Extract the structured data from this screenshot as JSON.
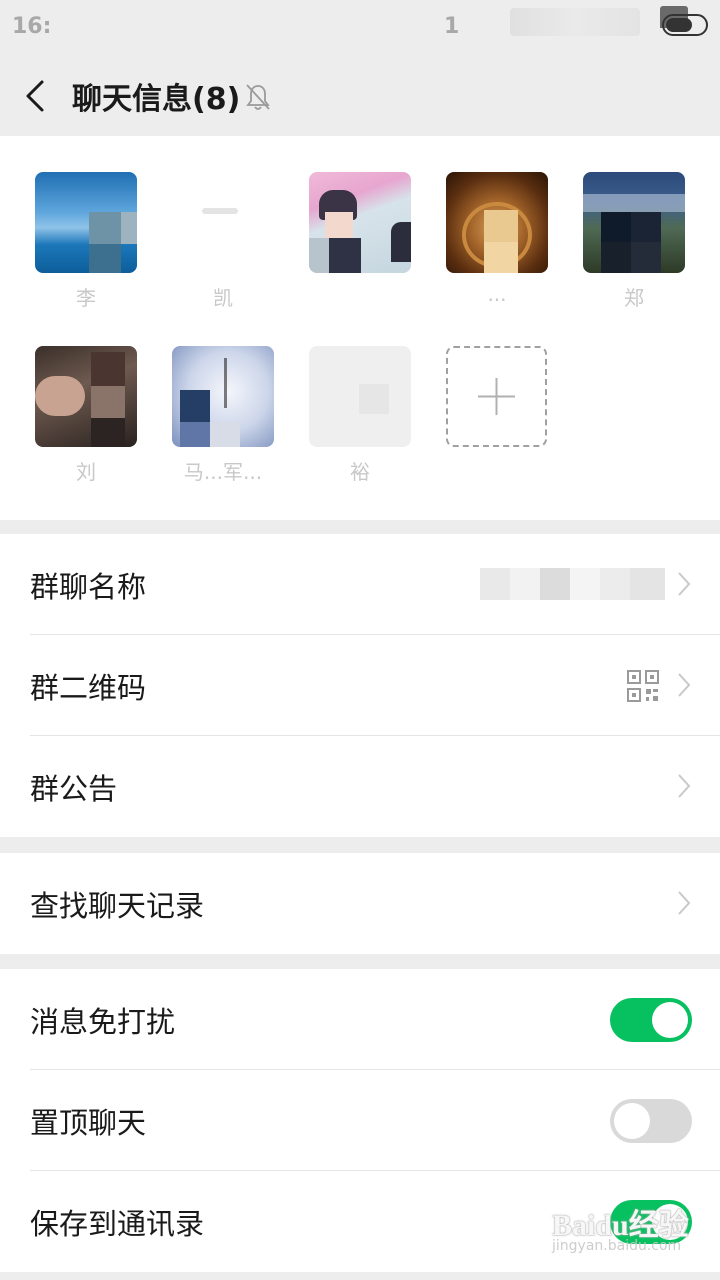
{
  "status_bar": {
    "time": "16:",
    "indicator": "1"
  },
  "header": {
    "title": "聊天信息(8)"
  },
  "members": [
    {
      "name": "李"
    },
    {
      "name": "凯"
    },
    {
      "name": ""
    },
    {
      "name": "..."
    },
    {
      "name": "郑"
    },
    {
      "name": "刘"
    },
    {
      "name": "马...军..."
    },
    {
      "name": "裕"
    }
  ],
  "settings": {
    "group_name_label": "群聊名称",
    "group_qr_label": "群二维码",
    "group_notice_label": "群公告",
    "search_history_label": "查找聊天记录",
    "mute_label": "消息免打扰",
    "sticky_label": "置顶聊天",
    "save_contacts_label": "保存到通讯录"
  },
  "toggles": {
    "mute": true,
    "sticky": false,
    "save_contacts": true
  },
  "colors": {
    "accent": "#07c160",
    "background": "#ededed",
    "toggle_off": "#d9d9d9"
  },
  "watermark": {
    "brand": "Baidu经验",
    "url": "jingyan.baidu.com"
  }
}
